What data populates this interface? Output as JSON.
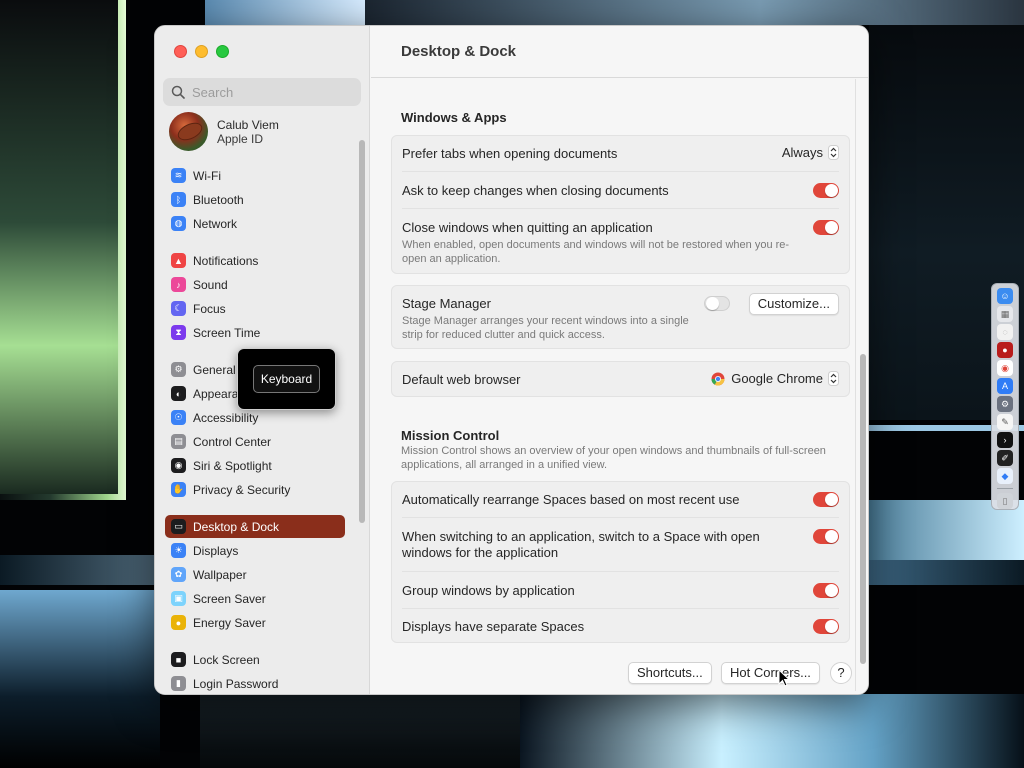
{
  "window": {
    "title": "Desktop & Dock"
  },
  "search": {
    "placeholder": "Search"
  },
  "account": {
    "name": "Calub Viem",
    "subtitle": "Apple ID"
  },
  "sidebar": {
    "items": [
      {
        "label": "Wi-Fi",
        "icon": "wifi-icon",
        "color": "#3b82f6"
      },
      {
        "label": "Bluetooth",
        "icon": "bluetooth-icon",
        "color": "#3b82f6"
      },
      {
        "label": "Network",
        "icon": "globe-icon",
        "color": "#3b82f6"
      },
      {
        "label": "Notifications",
        "icon": "bell-icon",
        "color": "#ef4444"
      },
      {
        "label": "Sound",
        "icon": "speaker-icon",
        "color": "#ec4899"
      },
      {
        "label": "Focus",
        "icon": "moon-icon",
        "color": "#6366f1"
      },
      {
        "label": "Screen Time",
        "icon": "hourglass-icon",
        "color": "#7c3aed"
      },
      {
        "label": "General",
        "icon": "gear-icon",
        "color": "#8e8e93"
      },
      {
        "label": "Appearance",
        "icon": "appearance-icon",
        "color": "#1c1c1e"
      },
      {
        "label": "Accessibility",
        "icon": "accessibility-icon",
        "color": "#3b82f6"
      },
      {
        "label": "Control Center",
        "icon": "control-center-icon",
        "color": "#8e8e93"
      },
      {
        "label": "Siri & Spotlight",
        "icon": "siri-icon",
        "color": "#1c1c1e"
      },
      {
        "label": "Privacy & Security",
        "icon": "hand-icon",
        "color": "#3b82f6"
      },
      {
        "label": "Desktop & Dock",
        "icon": "dock-icon",
        "color": "#1c1c1e"
      },
      {
        "label": "Displays",
        "icon": "sun-icon",
        "color": "#3b82f6"
      },
      {
        "label": "Wallpaper",
        "icon": "flower-icon",
        "color": "#60a5fa"
      },
      {
        "label": "Screen Saver",
        "icon": "screensaver-icon",
        "color": "#7dd3fc"
      },
      {
        "label": "Energy Saver",
        "icon": "bulb-icon",
        "color": "#eab308"
      },
      {
        "label": "Lock Screen",
        "icon": "lock-icon",
        "color": "#1c1c1e"
      },
      {
        "label": "Login Password",
        "icon": "password-icon",
        "color": "#8e8e93"
      }
    ],
    "active": "Desktop & Dock"
  },
  "tooltip": {
    "text": "Keyboard"
  },
  "windows_apps": {
    "title": "Windows & Apps",
    "prefer_tabs_label": "Prefer tabs when opening documents",
    "prefer_tabs_value": "Always",
    "ask_keep_label": "Ask to keep changes when closing documents",
    "ask_keep_on": true,
    "close_windows_label": "Close windows when quitting an application",
    "close_windows_desc": "When enabled, open documents and windows will not be restored when you re-open an application.",
    "close_windows_on": true
  },
  "stage_manager": {
    "label": "Stage Manager",
    "desc": "Stage Manager arranges your recent windows into a single strip for reduced clutter and quick access.",
    "on": false,
    "customize_label": "Customize..."
  },
  "browser": {
    "label": "Default web browser",
    "value": "Google Chrome"
  },
  "mission_control": {
    "title": "Mission Control",
    "desc": "Mission Control shows an overview of your open windows and thumbnails of full-screen applications, all arranged in a unified view.",
    "auto_rearrange_label": "Automatically rearrange Spaces based on most recent use",
    "auto_rearrange_on": true,
    "switch_space_label": "When switching to an application, switch to a Space with open windows for the application",
    "switch_space_on": true,
    "group_windows_label": "Group windows by application",
    "group_windows_on": true,
    "separate_spaces_label": "Displays have separate Spaces",
    "separate_spaces_on": true
  },
  "footer": {
    "shortcuts_label": "Shortcuts...",
    "hot_corners_label": "Hot Corners...",
    "help_label": "?"
  },
  "colors": {
    "accent": "#8a2e1b",
    "toggle_on": "#e0463a"
  }
}
